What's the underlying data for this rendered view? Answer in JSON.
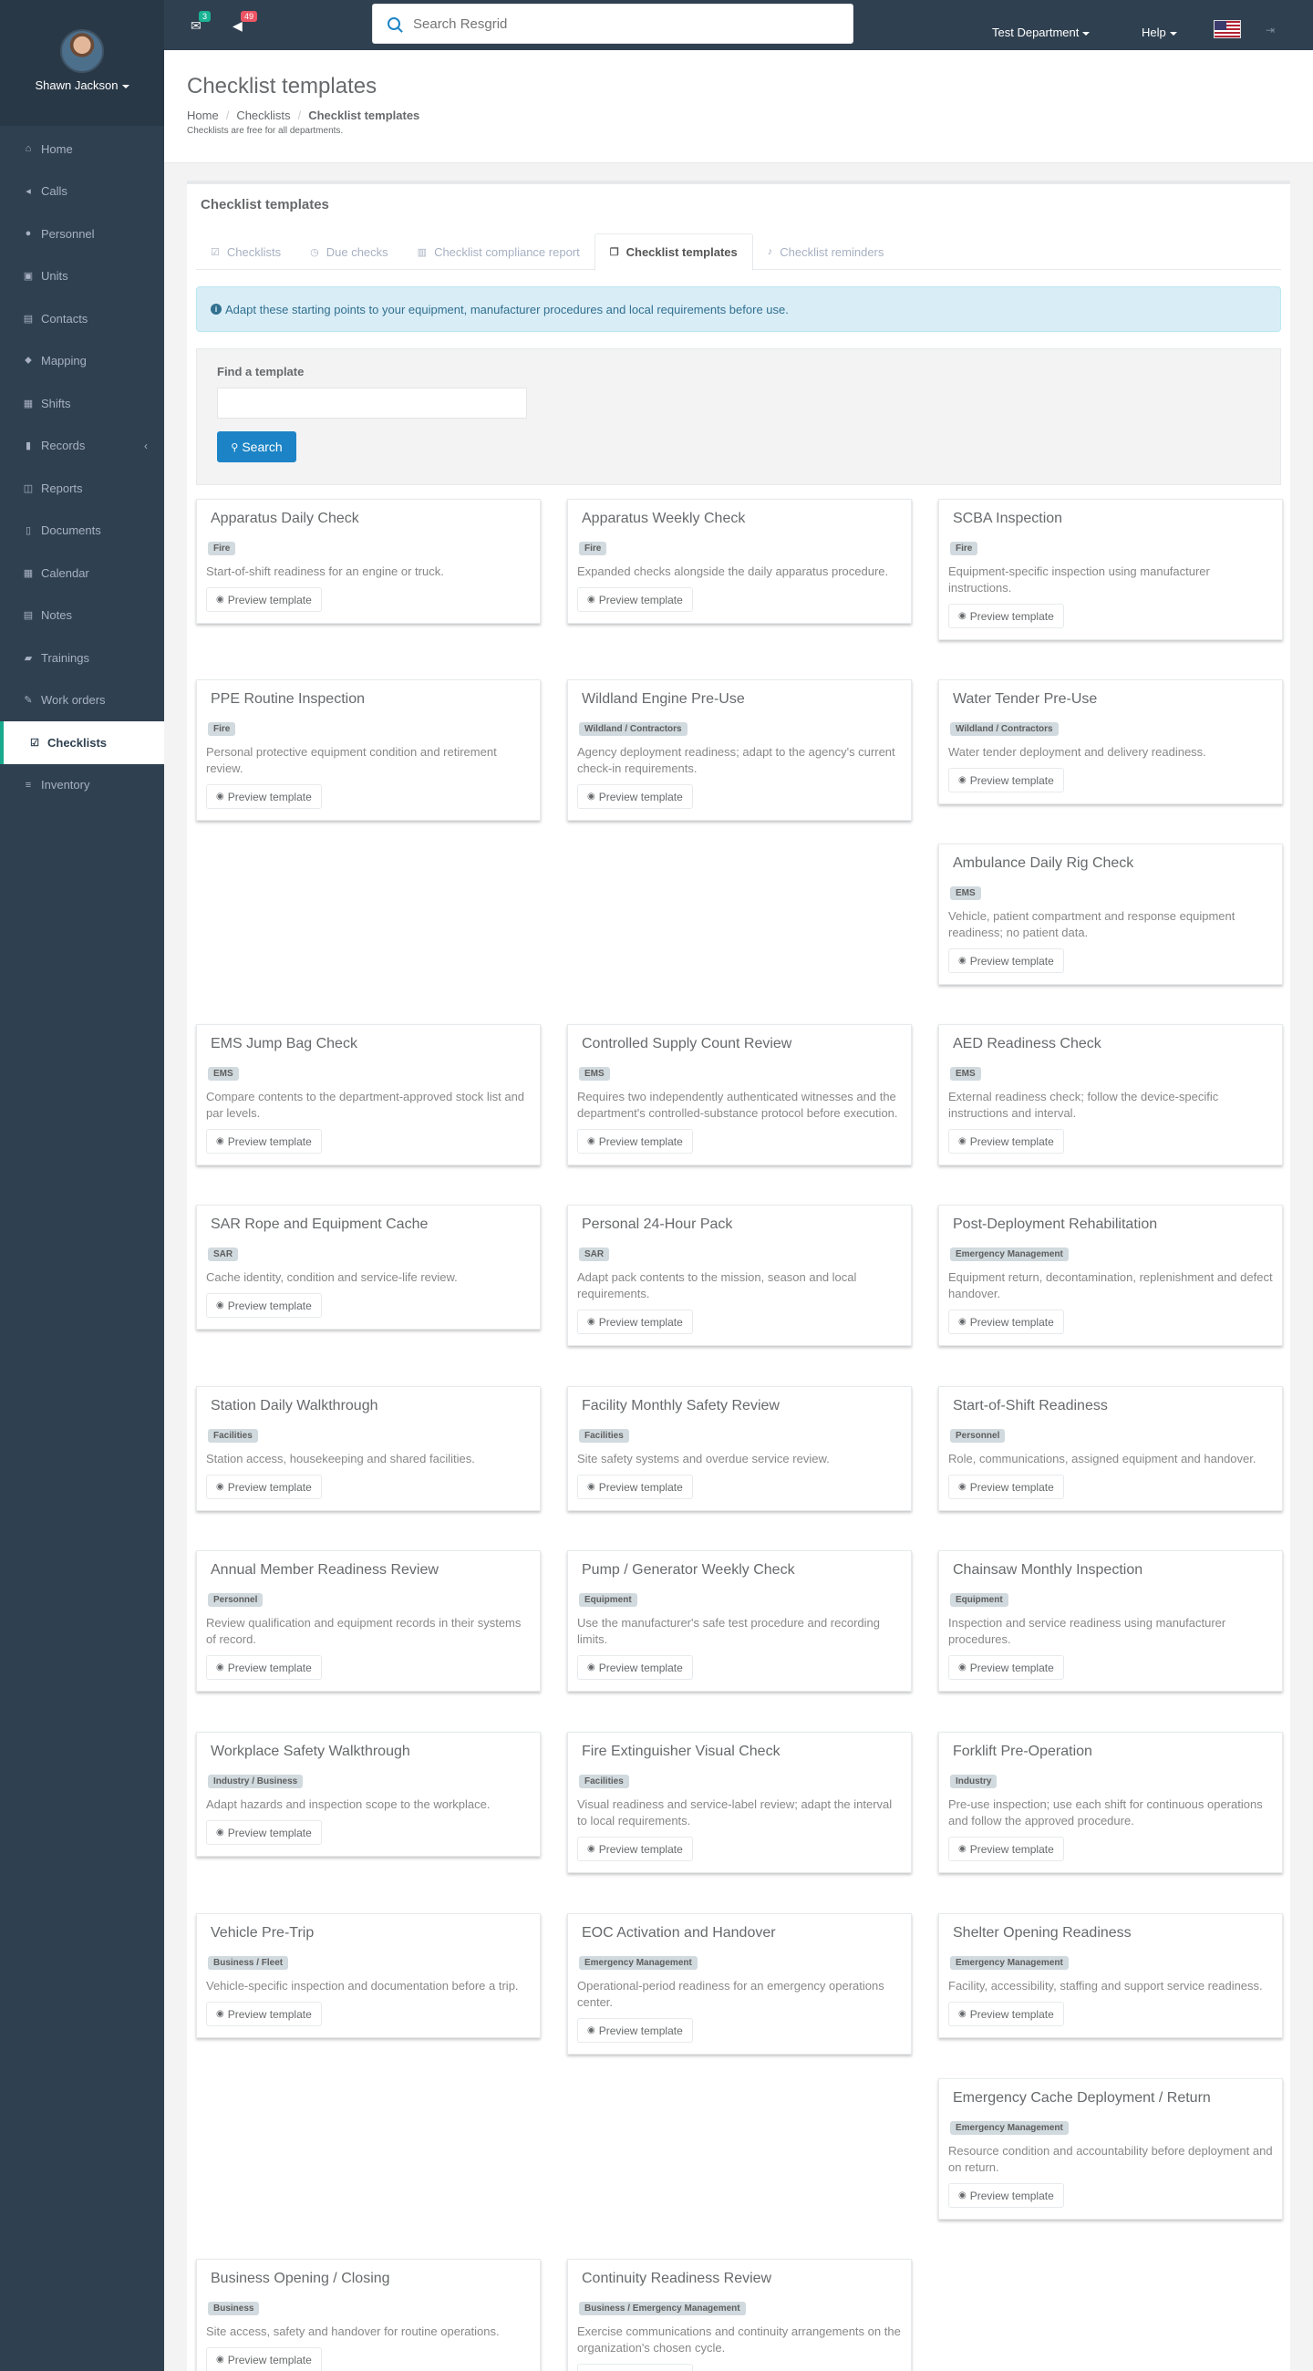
{
  "user": {
    "name": "Shawn Jackson"
  },
  "sidebar": {
    "items": [
      {
        "label": "Home",
        "icon": "home-icon",
        "glyph": "⌂"
      },
      {
        "label": "Calls",
        "icon": "bullhorn-icon",
        "glyph": "◂"
      },
      {
        "label": "Personnel",
        "icon": "user-icon",
        "glyph": "●"
      },
      {
        "label": "Units",
        "icon": "truck-icon",
        "glyph": "▣"
      },
      {
        "label": "Contacts",
        "icon": "address-book-icon",
        "glyph": "▤"
      },
      {
        "label": "Mapping",
        "icon": "map-marker-icon",
        "glyph": "⬥"
      },
      {
        "label": "Shifts",
        "icon": "shifts-icon",
        "glyph": "▦"
      },
      {
        "label": "Records",
        "icon": "book-icon",
        "glyph": "▮"
      },
      {
        "label": "Reports",
        "icon": "reports-icon",
        "glyph": "◫"
      },
      {
        "label": "Documents",
        "icon": "file-icon",
        "glyph": "▯"
      },
      {
        "label": "Calendar",
        "icon": "calendar-icon",
        "glyph": "▦"
      },
      {
        "label": "Notes",
        "icon": "notes-icon",
        "glyph": "▤"
      },
      {
        "label": "Trainings",
        "icon": "graduation-icon",
        "glyph": "▰"
      },
      {
        "label": "Work orders",
        "icon": "wrench-icon",
        "glyph": "✎"
      },
      {
        "label": "Checklists",
        "icon": "checklist-icon",
        "glyph": "☑",
        "active": true
      },
      {
        "label": "Inventory",
        "icon": "inventory-icon",
        "glyph": "≡"
      }
    ]
  },
  "topbar": {
    "mail_count": "3",
    "notification_count": "49",
    "search_placeholder": "Search Resgrid",
    "department": "Test Department",
    "help": "Help"
  },
  "colors": {
    "accent": "#1c84c6",
    "sidebar": "#2f4050",
    "mail_badge": "#1ab394",
    "notify_badge": "#ed5565"
  },
  "page": {
    "title": "Checklist templates",
    "breadcrumb": [
      "Home",
      "Checklists",
      "Checklist templates"
    ],
    "note": "Checklists are free for all departments."
  },
  "panel": {
    "title": "Checklist templates",
    "tabs": [
      {
        "label": "Checklists",
        "icon": "checkbox-icon",
        "glyph": "☑"
      },
      {
        "label": "Due checks",
        "icon": "clock-icon",
        "glyph": "◷"
      },
      {
        "label": "Checklist compliance report",
        "icon": "bar-chart-icon",
        "glyph": "▥"
      },
      {
        "label": "Checklist templates",
        "icon": "copy-icon",
        "glyph": "❐",
        "active": true
      },
      {
        "label": "Checklist reminders",
        "icon": "bell-icon",
        "glyph": "♪"
      }
    ],
    "alert": "Adapt these starting points to your equipment, manufacturer procedures and local requirements before use.",
    "find_label": "Find a template",
    "find_value": "",
    "search_button": "Search",
    "preview_label": "Preview template"
  },
  "templates": [
    {
      "title": "Apparatus Daily Check",
      "tag": "Fire",
      "desc": "Start-of-shift readiness for an engine or truck."
    },
    {
      "title": "Apparatus Weekly Check",
      "tag": "Fire",
      "desc": "Expanded checks alongside the daily apparatus procedure."
    },
    {
      "title": "SCBA Inspection",
      "tag": "Fire",
      "desc": "Equipment-specific inspection using manufacturer instructions."
    },
    {
      "title": "PPE Routine Inspection",
      "tag": "Fire",
      "desc": "Personal protective equipment condition and retirement review."
    },
    {
      "title": "Wildland Engine Pre-Use",
      "tag": "Wildland / Contractors",
      "desc": "Agency deployment readiness; adapt to the agency's current check-in requirements."
    },
    {
      "title": "Water Tender Pre-Use",
      "tag": "Wildland / Contractors",
      "desc": "Water tender deployment and delivery readiness."
    },
    {
      "title": "Ambulance Daily Rig Check",
      "tag": "EMS",
      "desc": "Vehicle, patient compartment and response equipment readiness; no patient data."
    },
    {
      "title": "EMS Jump Bag Check",
      "tag": "EMS",
      "desc": "Compare contents to the department-approved stock list and par levels."
    },
    {
      "title": "Controlled Supply Count Review",
      "tag": "EMS",
      "desc": "Requires two independently authenticated witnesses and the department's controlled-substance protocol before execution."
    },
    {
      "title": "AED Readiness Check",
      "tag": "EMS",
      "desc": "External readiness check; follow the device-specific instructions and interval."
    },
    {
      "title": "SAR Rope and Equipment Cache",
      "tag": "SAR",
      "desc": "Cache identity, condition and service-life review."
    },
    {
      "title": "Personal 24-Hour Pack",
      "tag": "SAR",
      "desc": "Adapt pack contents to the mission, season and local requirements."
    },
    {
      "title": "Post-Deployment Rehabilitation",
      "tag": "Emergency Management",
      "desc": "Equipment return, decontamination, replenishment and defect handover."
    },
    {
      "title": "Station Daily Walkthrough",
      "tag": "Facilities",
      "desc": "Station access, housekeeping and shared facilities."
    },
    {
      "title": "Facility Monthly Safety Review",
      "tag": "Facilities",
      "desc": "Site safety systems and overdue service review."
    },
    {
      "title": "Start-of-Shift Readiness",
      "tag": "Personnel",
      "desc": "Role, communications, assigned equipment and handover."
    },
    {
      "title": "Annual Member Readiness Review",
      "tag": "Personnel",
      "desc": "Review qualification and equipment records in their systems of record."
    },
    {
      "title": "Pump / Generator Weekly Check",
      "tag": "Equipment",
      "desc": "Use the manufacturer's safe test procedure and recording limits."
    },
    {
      "title": "Chainsaw Monthly Inspection",
      "tag": "Equipment",
      "desc": "Inspection and service readiness using manufacturer procedures."
    },
    {
      "title": "Workplace Safety Walkthrough",
      "tag": "Industry / Business",
      "desc": "Adapt hazards and inspection scope to the workplace."
    },
    {
      "title": "Fire Extinguisher Visual Check",
      "tag": "Facilities",
      "desc": "Visual readiness and service-label review; adapt the interval to local requirements."
    },
    {
      "title": "Forklift Pre-Operation",
      "tag": "Industry",
      "desc": "Pre-use inspection; use each shift for continuous operations and follow the approved procedure."
    },
    {
      "title": "Vehicle Pre-Trip",
      "tag": "Business / Fleet",
      "desc": "Vehicle-specific inspection and documentation before a trip."
    },
    {
      "title": "EOC Activation and Handover",
      "tag": "Emergency Management",
      "desc": "Operational-period readiness for an emergency operations center."
    },
    {
      "title": "Shelter Opening Readiness",
      "tag": "Emergency Management",
      "desc": "Facility, accessibility, staffing and support service readiness."
    },
    {
      "title": "Emergency Cache Deployment / Return",
      "tag": "Emergency Management",
      "desc": "Resource condition and accountability before deployment and on return."
    },
    {
      "title": "Business Opening / Closing",
      "tag": "Business",
      "desc": "Site access, safety and handover for routine operations."
    },
    {
      "title": "Continuity Readiness Review",
      "tag": "Business / Emergency Management",
      "desc": "Exercise communications and continuity arrangements on the organization's chosen cycle."
    }
  ]
}
